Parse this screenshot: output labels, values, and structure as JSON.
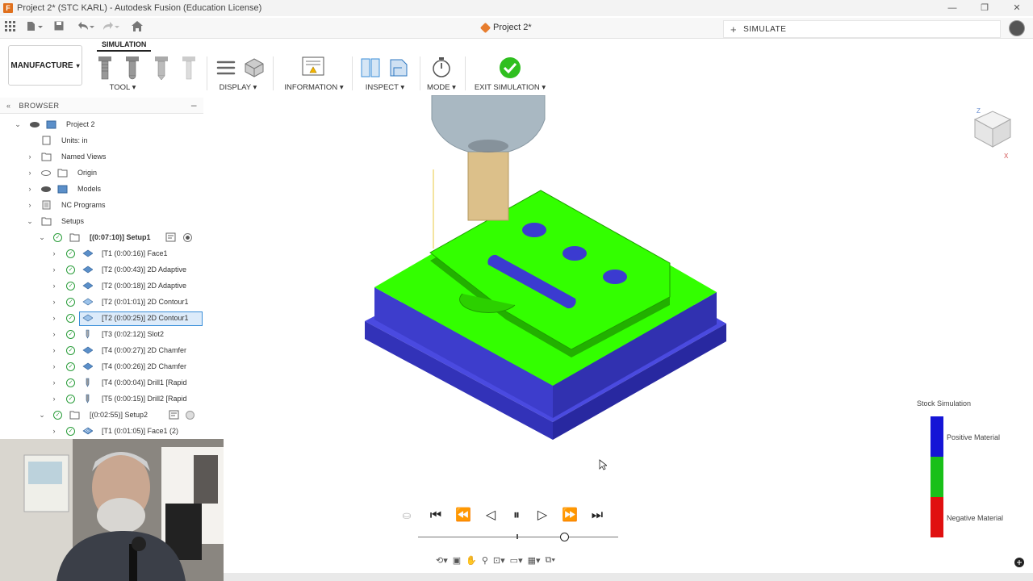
{
  "window": {
    "title": "Project 2* (STC KARL) - Autodesk Fusion (Education License)",
    "controls": [
      "—",
      "❐",
      "✕"
    ]
  },
  "tabs": {
    "document_title": "Project 2*",
    "simulate_label": "SIMULATE",
    "simulate_plus": "+"
  },
  "ribbon": {
    "workspace_label": "MANUFACTURE",
    "workspace_caret": "▾",
    "active_tab": "SIMULATION",
    "groups": {
      "tool": "TOOL ▾",
      "display": "DISPLAY ▾",
      "information": "INFORMATION ▾",
      "inspect": "INSPECT ▾",
      "mode": "MODE ▾",
      "exit": "EXIT SIMULATION ▾"
    }
  },
  "browser": {
    "title": "BROWSER",
    "collapse": "–",
    "root": "Project 2",
    "items": [
      {
        "label": "Units: in"
      },
      {
        "label": "Named Views"
      },
      {
        "label": "Origin"
      },
      {
        "label": "Models"
      },
      {
        "label": "NC Programs"
      },
      {
        "label": "Setups"
      }
    ],
    "setup1": {
      "label": "[(0:07:10)] Setup1",
      "ops": [
        "[T1 (0:00:16)] Face1",
        "[T2 (0:00:43)] 2D Adaptive",
        "[T2 (0:00:18)] 2D Adaptive",
        "[T2 (0:01:01)] 2D Contour1",
        "[T2 (0:00:25)] 2D Contour1",
        "[T3 (0:02:12)] Slot2",
        "[T4 (0:00:27)] 2D Chamfer",
        "[T4 (0:00:26)] 2D Chamfer",
        "[T4 (0:00:04)] Drill1 [Rapid",
        "[T5 (0:00:15)] Drill2 [Rapid"
      ]
    },
    "setup2": {
      "label": "[(0:02:55)] Setup2",
      "ops": [
        "[T1 (0:01:05)] Face1 (2)"
      ]
    }
  },
  "legend": {
    "title": "Stock Simulation",
    "positive": "Positive Material",
    "negative": "Negative Material",
    "colors": {
      "positive": "#1515d6",
      "neutral": "#19c019",
      "negative": "#e01010"
    }
  },
  "playback": {
    "position": 0.73
  },
  "viewcube": {
    "axis_z": "Z",
    "axis_x": "X"
  },
  "colors": {
    "stock_top": "#33ff00",
    "stock_side": "#3b3bd0",
    "tool_holder": "#a9b8c2",
    "tool_shank": "#dcc08a"
  }
}
